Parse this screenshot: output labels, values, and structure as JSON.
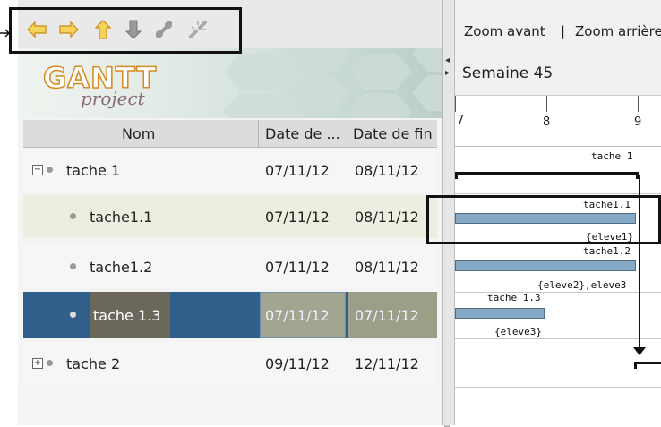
{
  "toolbar": {
    "icons": [
      "arrow-left-icon",
      "arrow-right-icon",
      "arrow-up-icon",
      "arrow-down-icon",
      "link-icon",
      "unlink-icon"
    ]
  },
  "logo": {
    "main": "GANTT",
    "sub": "project"
  },
  "table": {
    "headers": [
      "Nom",
      "Date de ...",
      "Date de fin"
    ],
    "rows": [
      {
        "name": "tache 1",
        "start": "07/11/12",
        "end": "08/11/12"
      },
      {
        "name": "tache1.1",
        "start": "07/11/12",
        "end": "08/11/12"
      },
      {
        "name": "tache1.2",
        "start": "07/11/12",
        "end": "08/11/12"
      },
      {
        "name": "tache 1.3",
        "start": "07/11/12",
        "end": "07/11/12"
      },
      {
        "name": "tache 2",
        "start": "09/11/12",
        "end": "12/11/12"
      }
    ]
  },
  "chart": {
    "zoom_in": "Zoom avant",
    "separator": "|",
    "zoom_out": "Zoom arrière",
    "week": "Semaine 45",
    "days": [
      "7",
      "8",
      "9"
    ],
    "labels": {
      "t1": "tache 1",
      "t11": "tache1.1",
      "t11_res": "{eleve1}",
      "t12": "tache1.2",
      "t12_res": "{eleve2},eleve3",
      "t13": "tache 1.3",
      "t13_res": "{eleve3}"
    }
  },
  "colors": {
    "selected_row": "#2f5f8a",
    "bar_fill": "#86aac5",
    "row_alt": "#eeeee0"
  }
}
